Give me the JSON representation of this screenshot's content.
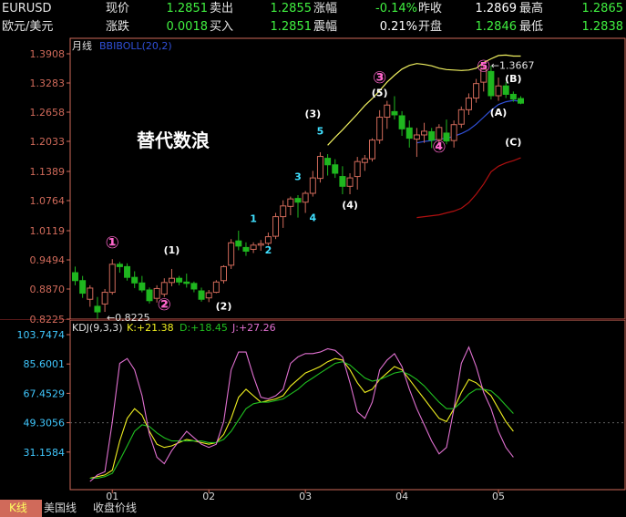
{
  "quote": {
    "symbol": "EURUSD",
    "name": "欧元/美元",
    "labels": {
      "price": "现价",
      "sell": "卖出",
      "change_pct": "涨幅",
      "prev_close": "昨收",
      "high": "最高",
      "change": "涨跌",
      "buy": "买入",
      "amplitude": "震幅",
      "open": "开盘",
      "low": "最低"
    },
    "values": {
      "price": "1.2851",
      "sell": "1.2855",
      "change_pct": "-0.14%",
      "prev_close": "1.2869",
      "high": "1.2865",
      "change": "0.0018",
      "buy": "1.2851",
      "amplitude": "0.21%",
      "open": "1.2846",
      "low": "1.2838"
    }
  },
  "bottom_tabs": [
    "K线",
    "美国线",
    "收盘价线"
  ],
  "colors": {
    "up": "#d06a5a",
    "down": "#1fb61f",
    "mid": "#3050d8",
    "lower": "#b01010",
    "upper": "#f0f060",
    "k": "#f0f020",
    "d": "#20c020",
    "j": "#e070d0",
    "wave_circle": "#ff66cc",
    "wave_num": "#40e0ff",
    "wave_text": "#ffffff",
    "axis": "#d06a5a"
  },
  "chart_data": [
    {
      "type": "candlestick",
      "period_label": "月线",
      "indicator_label": "BBIBOLL(20,2)",
      "ylim": [
        0.8225,
        1.3908
      ],
      "y_ticks": [
        "1.3908",
        "1.3283",
        "1.2658",
        "1.2033",
        "1.1389",
        "1.0764",
        "1.0119",
        "0.9494",
        "0.8870",
        "0.8225"
      ],
      "x_ticks": [
        "01",
        "02",
        "03",
        "04",
        "05"
      ],
      "title": "替代数浪",
      "low_label": "0.8225",
      "high_label": "1.3667",
      "candles": [
        {
          "o": 0.922,
          "h": 0.935,
          "l": 0.895,
          "c": 0.905
        },
        {
          "o": 0.905,
          "h": 0.915,
          "l": 0.868,
          "c": 0.878
        },
        {
          "o": 0.865,
          "h": 0.895,
          "l": 0.849,
          "c": 0.889
        },
        {
          "o": 0.85,
          "h": 0.87,
          "l": 0.823,
          "c": 0.838
        },
        {
          "o": 0.855,
          "h": 0.887,
          "l": 0.838,
          "c": 0.88
        },
        {
          "o": 0.88,
          "h": 0.951,
          "l": 0.875,
          "c": 0.94
        },
        {
          "o": 0.94,
          "h": 0.945,
          "l": 0.922,
          "c": 0.935
        },
        {
          "o": 0.935,
          "h": 0.942,
          "l": 0.905,
          "c": 0.912
        },
        {
          "o": 0.912,
          "h": 0.925,
          "l": 0.889,
          "c": 0.9
        },
        {
          "o": 0.9,
          "h": 0.915,
          "l": 0.88,
          "c": 0.885
        },
        {
          "o": 0.885,
          "h": 0.89,
          "l": 0.856,
          "c": 0.862
        },
        {
          "o": 0.867,
          "h": 0.895,
          "l": 0.858,
          "c": 0.888
        },
        {
          "o": 0.876,
          "h": 0.91,
          "l": 0.87,
          "c": 0.901
        },
        {
          "o": 0.901,
          "h": 0.93,
          "l": 0.893,
          "c": 0.91
        },
        {
          "o": 0.91,
          "h": 0.915,
          "l": 0.895,
          "c": 0.902
        },
        {
          "o": 0.902,
          "h": 0.92,
          "l": 0.89,
          "c": 0.899
        },
        {
          "o": 0.899,
          "h": 0.903,
          "l": 0.88,
          "c": 0.887
        },
        {
          "o": 0.883,
          "h": 0.89,
          "l": 0.86,
          "c": 0.865
        },
        {
          "o": 0.868,
          "h": 0.885,
          "l": 0.859,
          "c": 0.879
        },
        {
          "o": 0.88,
          "h": 0.906,
          "l": 0.878,
          "c": 0.902
        },
        {
          "o": 0.905,
          "h": 0.938,
          "l": 0.899,
          "c": 0.935
        },
        {
          "o": 0.938,
          "h": 0.994,
          "l": 0.93,
          "c": 0.986
        },
        {
          "o": 0.99,
          "h": 1.012,
          "l": 0.97,
          "c": 0.979
        },
        {
          "o": 0.976,
          "h": 0.987,
          "l": 0.958,
          "c": 0.968
        },
        {
          "o": 0.972,
          "h": 0.987,
          "l": 0.964,
          "c": 0.981
        },
        {
          "o": 0.981,
          "h": 0.992,
          "l": 0.969,
          "c": 0.984
        },
        {
          "o": 0.985,
          "h": 1.008,
          "l": 0.98,
          "c": 0.999
        },
        {
          "o": 1.0,
          "h": 1.05,
          "l": 0.994,
          "c": 1.042
        },
        {
          "o": 1.042,
          "h": 1.077,
          "l": 1.018,
          "c": 1.065
        },
        {
          "o": 1.064,
          "h": 1.085,
          "l": 1.045,
          "c": 1.08
        },
        {
          "o": 1.081,
          "h": 1.088,
          "l": 1.04,
          "c": 1.073
        },
        {
          "o": 1.073,
          "h": 1.097,
          "l": 1.05,
          "c": 1.092
        },
        {
          "o": 1.092,
          "h": 1.14,
          "l": 1.085,
          "c": 1.125
        },
        {
          "o": 1.124,
          "h": 1.18,
          "l": 1.115,
          "c": 1.171
        },
        {
          "o": 1.167,
          "h": 1.176,
          "l": 1.13,
          "c": 1.153
        },
        {
          "o": 1.153,
          "h": 1.165,
          "l": 1.125,
          "c": 1.135
        },
        {
          "o": 1.128,
          "h": 1.15,
          "l": 1.09,
          "c": 1.107
        },
        {
          "o": 1.107,
          "h": 1.135,
          "l": 1.09,
          "c": 1.125
        },
        {
          "o": 1.128,
          "h": 1.17,
          "l": 1.1,
          "c": 1.16
        },
        {
          "o": 1.158,
          "h": 1.174,
          "l": 1.14,
          "c": 1.166
        },
        {
          "o": 1.166,
          "h": 1.21,
          "l": 1.16,
          "c": 1.206
        },
        {
          "o": 1.206,
          "h": 1.27,
          "l": 1.198,
          "c": 1.255
        },
        {
          "o": 1.255,
          "h": 1.29,
          "l": 1.23,
          "c": 1.281
        },
        {
          "o": 1.267,
          "h": 1.3,
          "l": 1.25,
          "c": 1.26
        },
        {
          "o": 1.258,
          "h": 1.268,
          "l": 1.215,
          "c": 1.23
        },
        {
          "o": 1.232,
          "h": 1.248,
          "l": 1.19,
          "c": 1.21
        },
        {
          "o": 1.208,
          "h": 1.232,
          "l": 1.17,
          "c": 1.217
        },
        {
          "o": 1.217,
          "h": 1.243,
          "l": 1.2,
          "c": 1.225
        },
        {
          "o": 1.224,
          "h": 1.232,
          "l": 1.189,
          "c": 1.206
        },
        {
          "o": 1.207,
          "h": 1.24,
          "l": 1.195,
          "c": 1.233
        },
        {
          "o": 1.221,
          "h": 1.25,
          "l": 1.197,
          "c": 1.204
        },
        {
          "o": 1.205,
          "h": 1.248,
          "l": 1.19,
          "c": 1.239
        },
        {
          "o": 1.24,
          "h": 1.278,
          "l": 1.232,
          "c": 1.271
        },
        {
          "o": 1.271,
          "h": 1.306,
          "l": 1.26,
          "c": 1.296
        },
        {
          "o": 1.296,
          "h": 1.337,
          "l": 1.286,
          "c": 1.327
        },
        {
          "o": 1.33,
          "h": 1.367,
          "l": 1.31,
          "c": 1.358
        },
        {
          "o": 1.353,
          "h": 1.365,
          "l": 1.293,
          "c": 1.301
        },
        {
          "o": 1.301,
          "h": 1.34,
          "l": 1.29,
          "c": 1.322
        },
        {
          "o": 1.322,
          "h": 1.33,
          "l": 1.296,
          "c": 1.304
        },
        {
          "o": 1.304,
          "h": 1.31,
          "l": 1.288,
          "c": 1.294
        },
        {
          "o": 1.295,
          "h": 1.3,
          "l": 1.283,
          "c": 1.285
        }
      ],
      "series": [
        {
          "name": "upper",
          "values": [
            null,
            null,
            null,
            null,
            null,
            null,
            null,
            null,
            null,
            null,
            null,
            null,
            null,
            null,
            null,
            null,
            null,
            null,
            null,
            null,
            null,
            null,
            null,
            null,
            null,
            null,
            null,
            null,
            null,
            null,
            null,
            null,
            null,
            null,
            1.195,
            1.212,
            1.228,
            1.245,
            1.262,
            1.28,
            1.295,
            1.312,
            1.33,
            1.345,
            1.358,
            1.366,
            1.37,
            1.368,
            1.365,
            1.36,
            1.357,
            1.356,
            1.355,
            1.356,
            1.36,
            1.372,
            1.38,
            1.387,
            1.388,
            1.386,
            1.386
          ]
        },
        {
          "name": "mid",
          "values": [
            null,
            null,
            null,
            null,
            null,
            null,
            null,
            null,
            null,
            null,
            null,
            null,
            null,
            null,
            null,
            null,
            null,
            null,
            null,
            null,
            null,
            null,
            null,
            null,
            null,
            null,
            null,
            null,
            null,
            null,
            null,
            null,
            null,
            null,
            null,
            null,
            null,
            null,
            null,
            null,
            null,
            null,
            null,
            null,
            null,
            null,
            1.2,
            1.203,
            1.205,
            1.208,
            1.21,
            1.214,
            1.22,
            1.228,
            1.24,
            1.255,
            1.27,
            1.282,
            1.288,
            1.291,
            1.289
          ]
        },
        {
          "name": "lower",
          "values": [
            null,
            null,
            null,
            null,
            null,
            null,
            null,
            null,
            null,
            null,
            null,
            null,
            null,
            null,
            null,
            null,
            null,
            null,
            null,
            null,
            null,
            null,
            null,
            null,
            null,
            null,
            null,
            null,
            null,
            null,
            null,
            null,
            null,
            null,
            null,
            null,
            null,
            null,
            null,
            null,
            null,
            null,
            null,
            null,
            null,
            null,
            1.04,
            1.042,
            1.044,
            1.046,
            1.05,
            1.054,
            1.06,
            1.072,
            1.09,
            1.112,
            1.138,
            1.15,
            1.157,
            1.162,
            1.168
          ]
        }
      ],
      "annotations": [
        {
          "text": "①",
          "i": 5,
          "y": 0.975,
          "kind": "circle"
        },
        {
          "text": "(1)",
          "i": 13,
          "y": 0.963,
          "kind": "paren"
        },
        {
          "text": "②",
          "i": 12,
          "y": 0.842,
          "kind": "circle"
        },
        {
          "text": "(2)",
          "i": 20,
          "y": 0.843,
          "kind": "paren"
        },
        {
          "text": "1",
          "i": 24,
          "y": 1.03,
          "kind": "num"
        },
        {
          "text": "2",
          "i": 26,
          "y": 0.963,
          "kind": "num"
        },
        {
          "text": "3",
          "i": 30,
          "y": 1.12,
          "kind": "num"
        },
        {
          "text": "4",
          "i": 32,
          "y": 1.032,
          "kind": "num"
        },
        {
          "text": "5",
          "i": 33,
          "y": 1.218,
          "kind": "num"
        },
        {
          "text": "(3)",
          "i": 32,
          "y": 1.255,
          "kind": "paren"
        },
        {
          "text": "(4)",
          "i": 37,
          "y": 1.06,
          "kind": "paren"
        },
        {
          "text": "③",
          "i": 41,
          "y": 1.328,
          "kind": "circle"
        },
        {
          "text": "(5)",
          "i": 41,
          "y": 1.3,
          "kind": "paren"
        },
        {
          "text": "④",
          "i": 49,
          "y": 1.18,
          "kind": "circle"
        },
        {
          "text": "⑤",
          "i": 55,
          "y": 1.353,
          "kind": "circle"
        },
        {
          "text": "(B)",
          "i": 59,
          "y": 1.33,
          "kind": "paren"
        },
        {
          "text": "(A)",
          "i": 57,
          "y": 1.258,
          "kind": "paren"
        },
        {
          "text": "(C)",
          "i": 59,
          "y": 1.195,
          "kind": "paren"
        }
      ]
    },
    {
      "type": "line",
      "indicator_label": "KDJ(9,3,3)",
      "legend": [
        {
          "name": "K",
          "value": "21.38"
        },
        {
          "name": "D",
          "value": "18.45"
        },
        {
          "name": "J",
          "value": "27.26"
        }
      ],
      "ylim": [
        13.0,
        103.7474
      ],
      "y_ticks": [
        "103.7474",
        "85.6001",
        "67.4529",
        "49.3056",
        "31.1584"
      ],
      "reference_line": 49.3056,
      "series": [
        {
          "name": "K",
          "values": [
            15,
            16,
            17,
            20,
            38,
            52,
            58,
            54,
            44,
            36,
            34,
            35,
            37,
            39,
            38,
            37,
            36,
            37,
            42,
            52,
            65,
            70,
            66,
            62,
            63,
            64,
            66,
            72,
            76,
            80,
            82,
            84,
            87,
            89,
            88,
            82,
            74,
            68,
            70,
            76,
            80,
            84,
            82,
            76,
            70,
            64,
            58,
            52,
            50,
            58,
            68,
            76,
            74,
            70,
            66,
            58,
            50,
            44
          ]
        },
        {
          "name": "D",
          "values": [
            15,
            15,
            16,
            18,
            26,
            35,
            44,
            48,
            47,
            43,
            40,
            38,
            38,
            38,
            38,
            38,
            37,
            37,
            39,
            44,
            51,
            58,
            61,
            62,
            62,
            63,
            64,
            67,
            70,
            74,
            77,
            80,
            83,
            86,
            87,
            85,
            81,
            77,
            75,
            76,
            78,
            80,
            81,
            79,
            76,
            72,
            67,
            62,
            58,
            58,
            62,
            67,
            70,
            70,
            69,
            65,
            60,
            55
          ]
        },
        {
          "name": "J",
          "values": [
            13,
            17,
            19,
            50,
            86,
            89,
            82,
            66,
            42,
            28,
            24,
            32,
            38,
            44,
            40,
            36,
            34,
            36,
            50,
            82,
            93,
            93,
            78,
            65,
            64,
            66,
            70,
            86,
            90,
            92,
            92,
            93,
            95,
            94,
            90,
            74,
            56,
            52,
            62,
            82,
            88,
            92,
            84,
            70,
            58,
            48,
            38,
            30,
            34,
            58,
            86,
            96,
            84,
            68,
            58,
            44,
            34,
            28
          ]
        }
      ]
    }
  ]
}
